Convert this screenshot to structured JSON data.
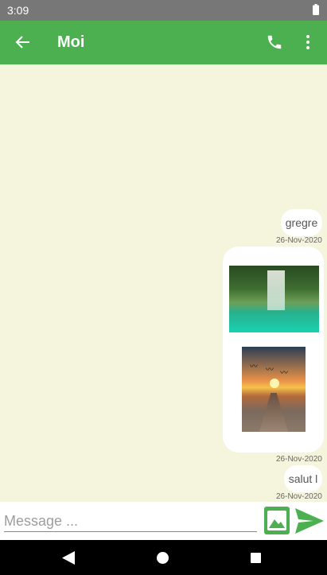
{
  "status_bar": {
    "time": "3:09"
  },
  "app_bar": {
    "title": "Moi"
  },
  "messages": [
    {
      "type": "text",
      "text": "gregre",
      "timestamp": "26-Nov-2020"
    },
    {
      "type": "images",
      "images": [
        "waterfall-lagoon-photo",
        "sunset-pier-photo"
      ],
      "timestamp": "26-Nov-2020"
    },
    {
      "type": "text",
      "text": "salut l",
      "timestamp": "26-Nov-2020"
    }
  ],
  "composer": {
    "placeholder": "Message ...",
    "value": ""
  },
  "colors": {
    "primary": "#4caf50",
    "chat_background": "#f5f4dc",
    "status_bar": "#777777"
  }
}
